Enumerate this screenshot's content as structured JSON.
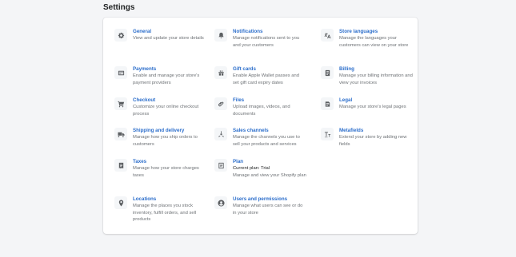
{
  "page": {
    "title": "Settings"
  },
  "settings": {
    "general": {
      "title": "General",
      "desc": "View and update your store details",
      "icon": "gear-icon"
    },
    "notifications": {
      "title": "Notifications",
      "desc": "Manage notifications sent to you and your customers",
      "icon": "bell-icon"
    },
    "store_languages": {
      "title": "Store languages",
      "desc": "Manage the languages your customers can view on your store",
      "icon": "translate-icon"
    },
    "payments": {
      "title": "Payments",
      "desc": "Enable and manage your store's payment providers",
      "icon": "payment-card-icon"
    },
    "gift_cards": {
      "title": "Gift cards",
      "desc": "Enable Apple Wallet passes and set gift card expiry dates",
      "icon": "gift-icon"
    },
    "billing": {
      "title": "Billing",
      "desc": "Manage your billing information and view your invoices",
      "icon": "billing-icon"
    },
    "checkout": {
      "title": "Checkout",
      "desc": "Customize your online checkout process",
      "icon": "cart-icon"
    },
    "files": {
      "title": "Files",
      "desc": "Upload images, videos, and documents",
      "icon": "paperclip-icon"
    },
    "legal": {
      "title": "Legal",
      "desc": "Manage your store's legal pages",
      "icon": "document-icon"
    },
    "shipping": {
      "title": "Shipping and delivery",
      "desc": "Manage how you ship orders to customers",
      "icon": "truck-icon"
    },
    "sales_channels": {
      "title": "Sales channels",
      "desc": "Manage the channels you use to sell your products and services",
      "icon": "channels-icon"
    },
    "metafields": {
      "title": "Metafields",
      "desc": "Extend your store by adding new fields",
      "icon": "metafields-icon"
    },
    "taxes": {
      "title": "Taxes",
      "desc": "Manage how your store charges taxes",
      "icon": "receipt-icon"
    },
    "plan": {
      "title": "Plan",
      "subtitle": "Current plan: Trial",
      "desc": "Manage and view your Shopify plan",
      "icon": "plan-icon"
    },
    "locations": {
      "title": "Locations",
      "desc": "Manage the places you stock inventory, fulfill orders, and sell products",
      "icon": "location-pin-icon"
    },
    "users": {
      "title": "Users and permissions",
      "desc": "Manage what users can see or do in your store",
      "icon": "user-icon"
    }
  }
}
